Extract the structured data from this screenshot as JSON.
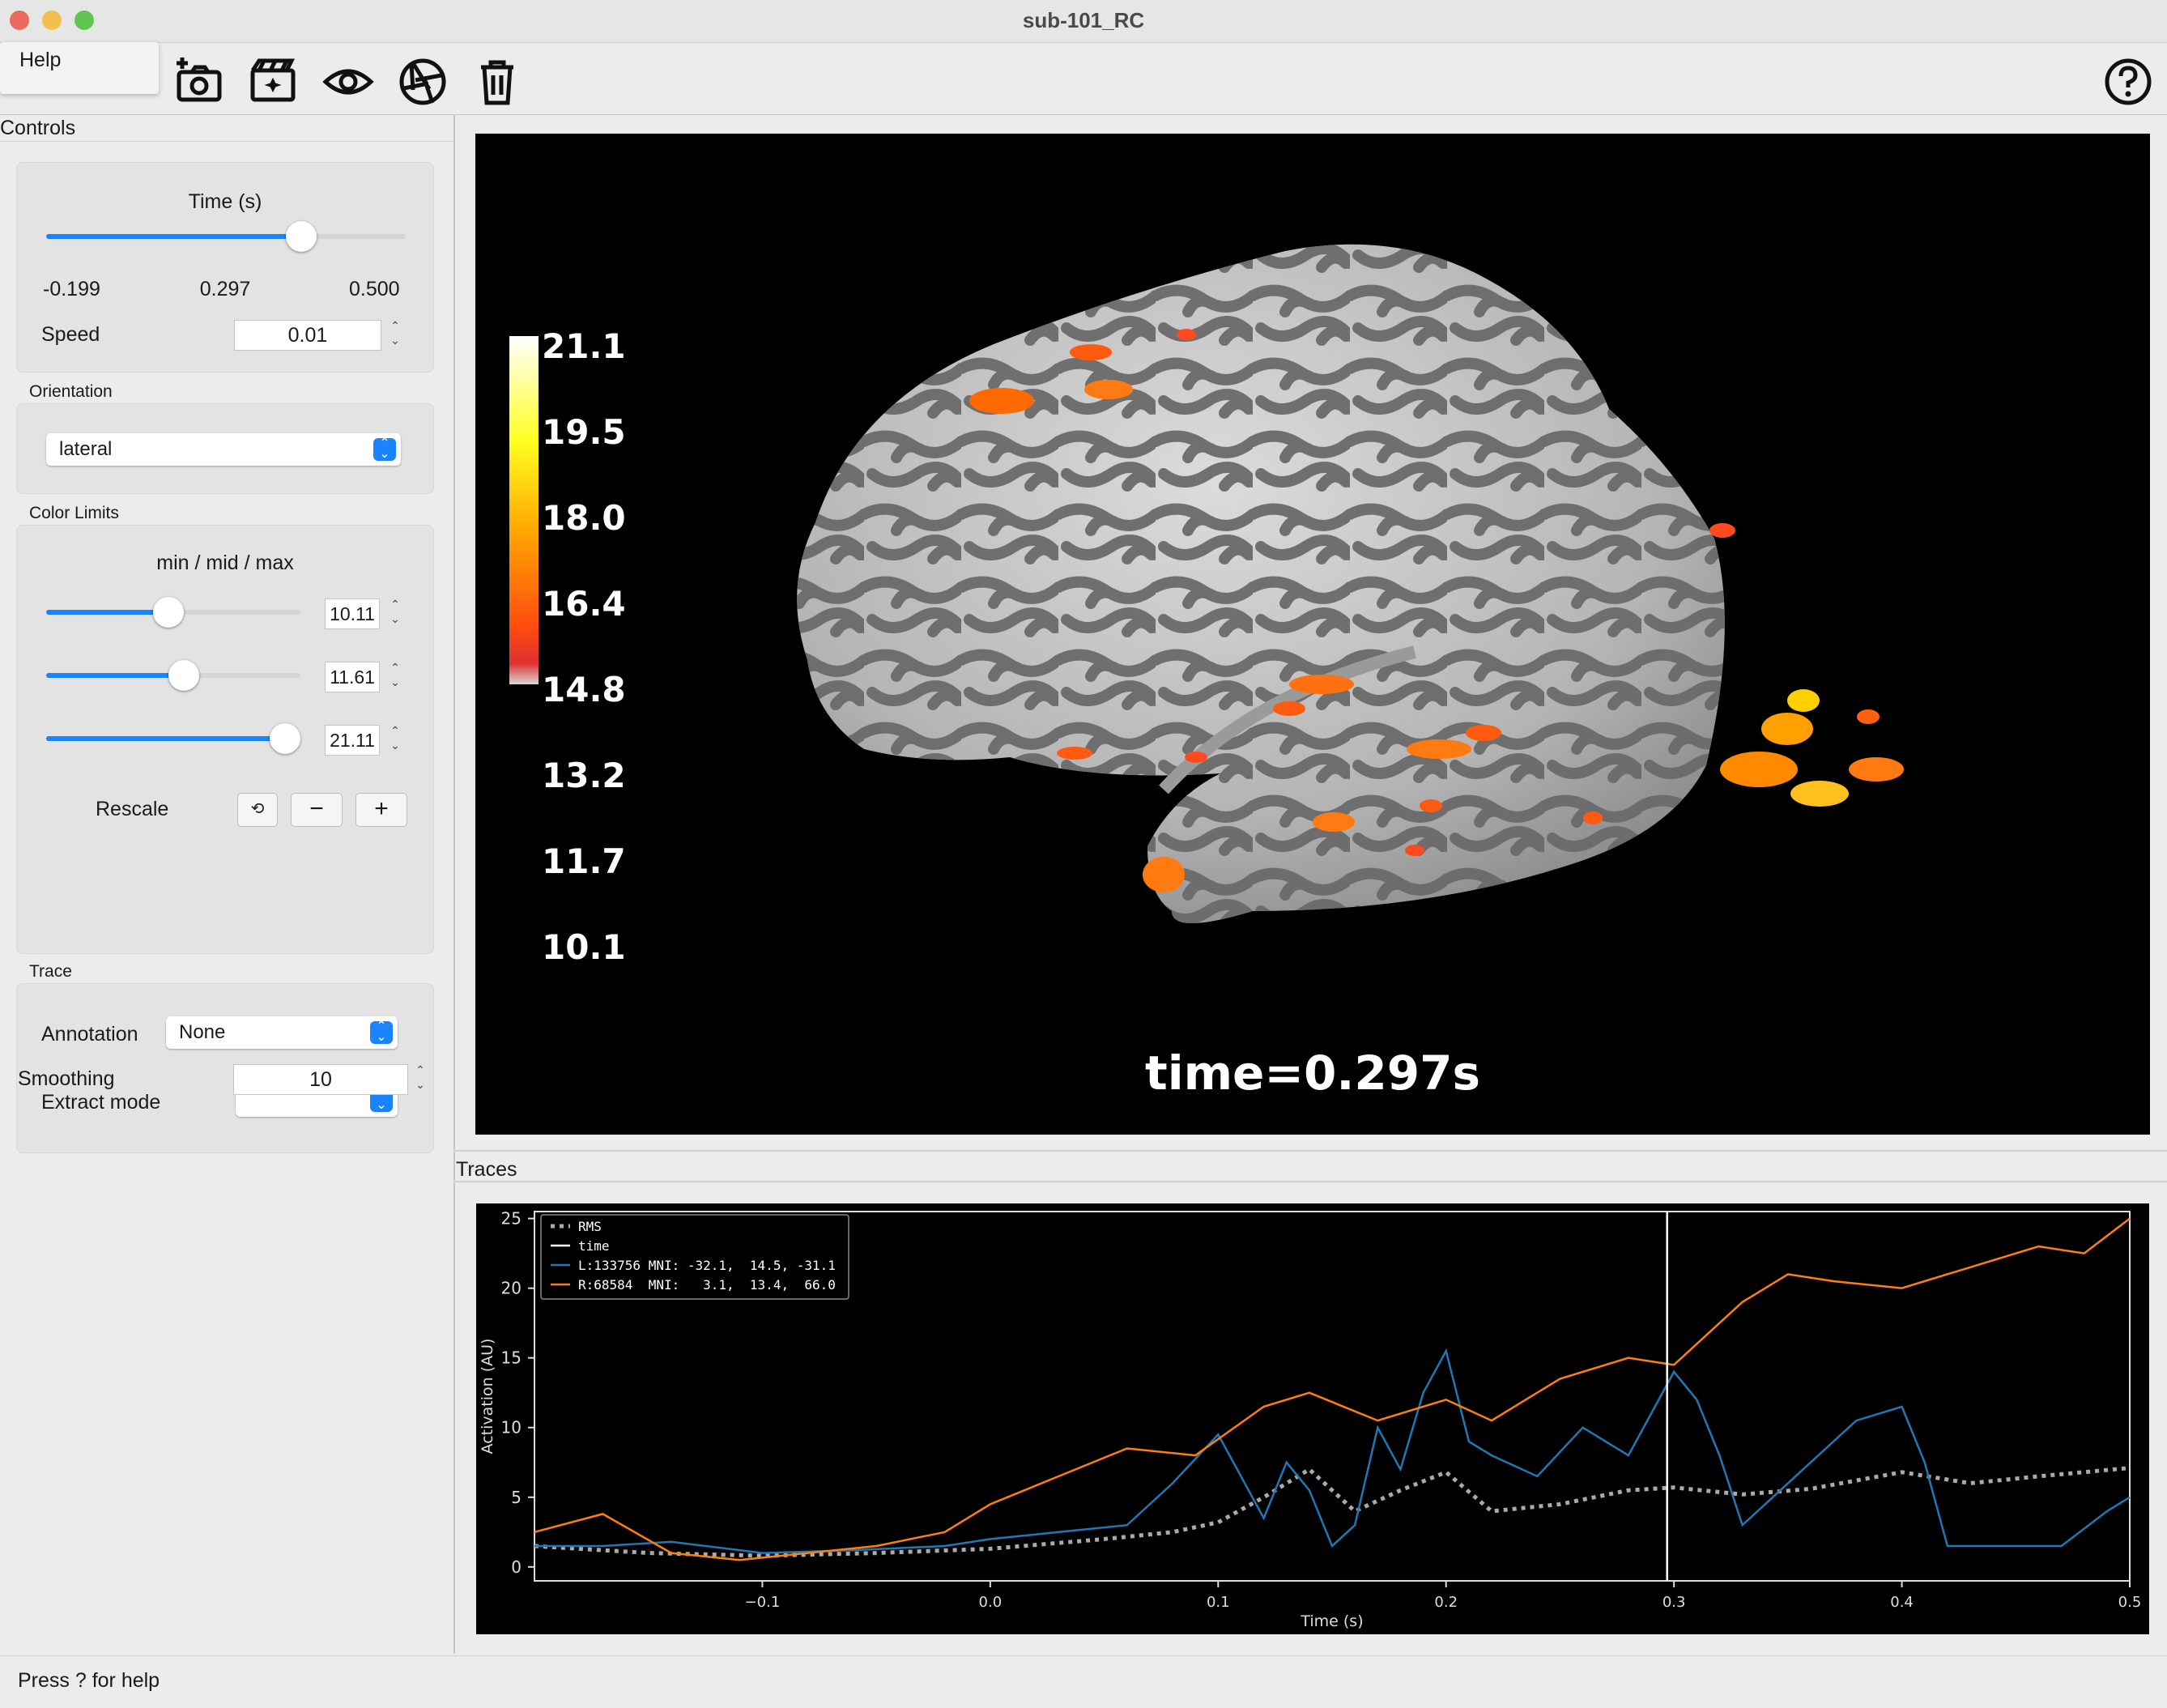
{
  "window": {
    "title": "sub-101_RC"
  },
  "menu": {
    "help_label": "Help"
  },
  "toolbar": {
    "buttons": [
      {
        "icon": "camera-add-icon"
      },
      {
        "icon": "movie-icon"
      },
      {
        "icon": "eye-icon"
      },
      {
        "icon": "aperture-icon"
      },
      {
        "icon": "trash-icon"
      },
      {
        "icon": "help-circle-icon"
      }
    ]
  },
  "controls": {
    "header": "Controls",
    "time": {
      "label": "Time (s)",
      "min": "-0.199",
      "current": "0.297",
      "max": "0.500",
      "fraction": 0.71,
      "speed_label": "Speed",
      "speed_value": "0.01"
    },
    "orientation": {
      "label": "Orientation",
      "value": "lateral"
    },
    "color_limits": {
      "label": "Color Limits",
      "sublabel": "min / mid / max",
      "min": "10.11",
      "mid": "11.61",
      "max": "21.11",
      "min_fraction": 0.48,
      "mid_fraction": 0.54,
      "max_fraction": 0.94,
      "rescale_label": "Rescale",
      "reset_glyph": "⟲",
      "minus_glyph": "−",
      "plus_glyph": "+"
    },
    "trace": {
      "label": "Trace",
      "annotation_label": "Annotation",
      "annotation_value": "None",
      "extract_label": "Extract mode",
      "extract_value": ""
    },
    "smoothing": {
      "label": "Smoothing",
      "value": "10"
    }
  },
  "viewer": {
    "colorbar_ticks": [
      "21.1",
      "19.5",
      "18.0",
      "16.4",
      "14.8",
      "13.2",
      "11.7",
      "10.1"
    ],
    "time_text": "time=0.297s",
    "colors": {
      "background": "#000000",
      "sulci": "#6a6a6a",
      "gyri": "#c8c8c8",
      "hot_low": "#ff3c1e",
      "hot_high": "#ffffff"
    }
  },
  "traces": {
    "header": "Traces",
    "legend": [
      "RMS",
      "time",
      "L:133756 MNI: -32.1,  14.5, -31.1",
      "R:68584  MNI:   3.1,  13.4,  66.0"
    ]
  },
  "chart_data": {
    "type": "line",
    "xlabel": "Time (s)",
    "ylabel": "Activation (AU)",
    "xlim": [
      -0.2,
      0.5
    ],
    "ylim": [
      -1,
      25.5
    ],
    "xticks": [
      "−0.1",
      "0.0",
      "0.1",
      "0.2",
      "0.3",
      "0.4",
      "0.5"
    ],
    "xtick_values": [
      -0.1,
      0.0,
      0.1,
      0.2,
      0.3,
      0.4,
      0.5
    ],
    "yticks": [
      "0",
      "5",
      "10",
      "15",
      "20",
      "25"
    ],
    "ytick_values": [
      0,
      5,
      10,
      15,
      20,
      25
    ],
    "time_marker": 0.297,
    "legend_position": "top-left",
    "series": [
      {
        "name": "RMS",
        "color": "#aaaaaa",
        "style": "dotted",
        "x": [
          -0.2,
          -0.15,
          -0.1,
          -0.05,
          0.0,
          0.05,
          0.08,
          0.1,
          0.12,
          0.14,
          0.16,
          0.18,
          0.2,
          0.22,
          0.25,
          0.28,
          0.3,
          0.33,
          0.36,
          0.4,
          0.43,
          0.46,
          0.5
        ],
        "y": [
          1.5,
          1.0,
          0.8,
          1.0,
          1.3,
          2.0,
          2.5,
          3.2,
          5.0,
          7.0,
          4.0,
          5.5,
          6.8,
          4.0,
          4.5,
          5.5,
          5.7,
          5.2,
          5.6,
          6.8,
          6.0,
          6.5,
          7.1
        ]
      },
      {
        "name": "L:133756 MNI: -32.1,  14.5, -31.1",
        "color": "#1f77b4",
        "style": "solid",
        "x": [
          -0.2,
          -0.17,
          -0.14,
          -0.1,
          -0.06,
          -0.02,
          0.0,
          0.03,
          0.06,
          0.08,
          0.1,
          0.12,
          0.13,
          0.14,
          0.15,
          0.16,
          0.17,
          0.18,
          0.19,
          0.2,
          0.21,
          0.22,
          0.24,
          0.26,
          0.28,
          0.29,
          0.3,
          0.31,
          0.32,
          0.33,
          0.34,
          0.36,
          0.38,
          0.4,
          0.41,
          0.42,
          0.43,
          0.45,
          0.47,
          0.49,
          0.5
        ],
        "y": [
          1.5,
          1.5,
          1.8,
          1.0,
          1.2,
          1.5,
          2.0,
          2.5,
          3.0,
          6.0,
          9.5,
          3.5,
          7.5,
          5.5,
          1.5,
          3.0,
          10.0,
          7.0,
          12.5,
          15.5,
          9.0,
          8.0,
          6.5,
          10.0,
          8.0,
          11.0,
          14.0,
          12.0,
          8.0,
          3.0,
          4.5,
          7.5,
          10.5,
          11.5,
          7.5,
          1.5,
          1.5,
          1.5,
          1.5,
          4.0,
          5.0
        ]
      },
      {
        "name": "R:68584  MNI:   3.1,  13.4,  66.0",
        "color": "#ff7f0e",
        "style": "solid",
        "x": [
          -0.2,
          -0.17,
          -0.14,
          -0.11,
          -0.08,
          -0.05,
          -0.02,
          0.0,
          0.03,
          0.06,
          0.09,
          0.12,
          0.14,
          0.17,
          0.2,
          0.22,
          0.25,
          0.28,
          0.3,
          0.33,
          0.35,
          0.37,
          0.4,
          0.43,
          0.46,
          0.48,
          0.5
        ],
        "y": [
          2.5,
          3.8,
          1.0,
          0.5,
          1.0,
          1.5,
          2.5,
          4.5,
          6.5,
          8.5,
          8.0,
          11.5,
          12.5,
          10.5,
          12.0,
          10.5,
          13.5,
          15.0,
          14.5,
          19.0,
          21.0,
          20.5,
          20.0,
          21.5,
          23.0,
          22.5,
          25.0
        ]
      }
    ]
  }
}
